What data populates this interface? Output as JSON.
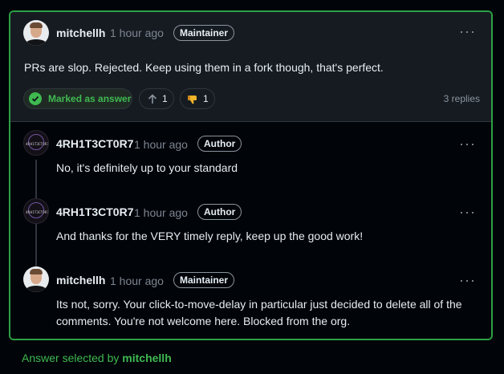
{
  "main_comment": {
    "author": "mitchellh",
    "time": "1 hour ago",
    "role": "Maintainer",
    "body": "PRs are slop. Rejected. Keep using them in a fork though, that's perfect.",
    "answer_label": "Marked as answer",
    "upvotes": "1",
    "thumbs_down": "1",
    "replies": "3 replies",
    "more": "···"
  },
  "replies": [
    {
      "author": "4RH1T3CT0R7",
      "time": "1 hour ago",
      "role": "Author",
      "body": "No, it's definitely up to your standard",
      "avatar_text": "4RH1T3CT0R7",
      "more": "···"
    },
    {
      "author": "4RH1T3CT0R7",
      "time": "1 hour ago",
      "role": "Author",
      "body": "And thanks for the VERY timely reply, keep up the good work!",
      "avatar_text": "4RH1T3CT0R7",
      "more": "···"
    },
    {
      "author": "mitchellh",
      "time": "1 hour ago",
      "role": "Maintainer",
      "body_line1": "Its not, sorry. Your click-to-move-delay in particular just decided to delete all of the",
      "body_line2": "comments. You're not welcome here. Blocked from the org.",
      "more": "···"
    }
  ],
  "footer": {
    "prefix": "Answer selected by ",
    "user": "mitchellh"
  },
  "colors": {
    "accent_green": "#3fb950",
    "border_green": "#2ea043",
    "background": "#010409"
  },
  "icons": [
    "check-circle-icon",
    "arrow-up-icon",
    "thumbs-down-icon",
    "kebab-menu-icon"
  ]
}
